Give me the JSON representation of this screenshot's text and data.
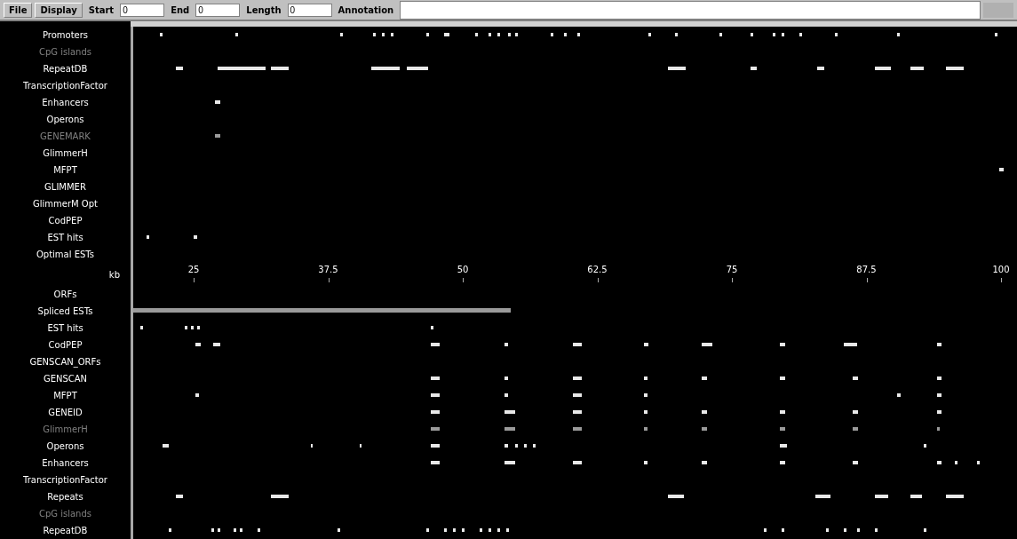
{
  "toolbar": {
    "buttons": [
      "File",
      "Display"
    ],
    "fields": [
      {
        "label": "Start",
        "value": "0"
      },
      {
        "label": "End",
        "value": "0"
      },
      {
        "label": "Length",
        "value": "0"
      }
    ],
    "annotation_label": "Annotation"
  },
  "upper_tracks": [
    {
      "label": "Promoters",
      "dimmed": false
    },
    {
      "label": "CpG islands",
      "dimmed": true
    },
    {
      "label": "RepeatDB",
      "dimmed": false
    },
    {
      "label": "TranscriptionFactor",
      "dimmed": false
    },
    {
      "label": "Enhancers",
      "dimmed": false
    },
    {
      "label": "Operons",
      "dimmed": false
    },
    {
      "label": "GENEMARK",
      "dimmed": true
    },
    {
      "label": "GlimmerH",
      "dimmed": false
    },
    {
      "label": "MFPT",
      "dimmed": false
    },
    {
      "label": "GLIMMER",
      "dimmed": false
    },
    {
      "label": "GlimmerM Opt",
      "dimmed": false
    },
    {
      "label": "CodPEP",
      "dimmed": false
    },
    {
      "label": "EST hits",
      "dimmed": false
    },
    {
      "label": "Optimal ESTs",
      "dimmed": false
    }
  ],
  "scale": {
    "unit": "kb",
    "ticks": [
      "25",
      "37.5",
      "50",
      "62.5",
      "75",
      "87.5",
      "100"
    ]
  },
  "lower_tracks": [
    {
      "label": "ORFs",
      "dimmed": false
    },
    {
      "label": "Spliced ESTs",
      "dimmed": false
    },
    {
      "label": "EST hits",
      "dimmed": false
    },
    {
      "label": "CodPEP",
      "dimmed": false
    },
    {
      "label": "GENSCAN_ORFs",
      "dimmed": false
    },
    {
      "label": "GENSCAN",
      "dimmed": false
    },
    {
      "label": "MFPT",
      "dimmed": false
    },
    {
      "label": "GENEID",
      "dimmed": false
    },
    {
      "label": "GlimmerH",
      "dimmed": true
    },
    {
      "label": "Operons",
      "dimmed": false
    },
    {
      "label": "Enhancers",
      "dimmed": false
    },
    {
      "label": "TranscriptionFactor",
      "dimmed": false
    },
    {
      "label": "Repeats",
      "dimmed": false
    },
    {
      "label": "CpG islands",
      "dimmed": true
    },
    {
      "label": "RepeatDB",
      "dimmed": false
    }
  ]
}
